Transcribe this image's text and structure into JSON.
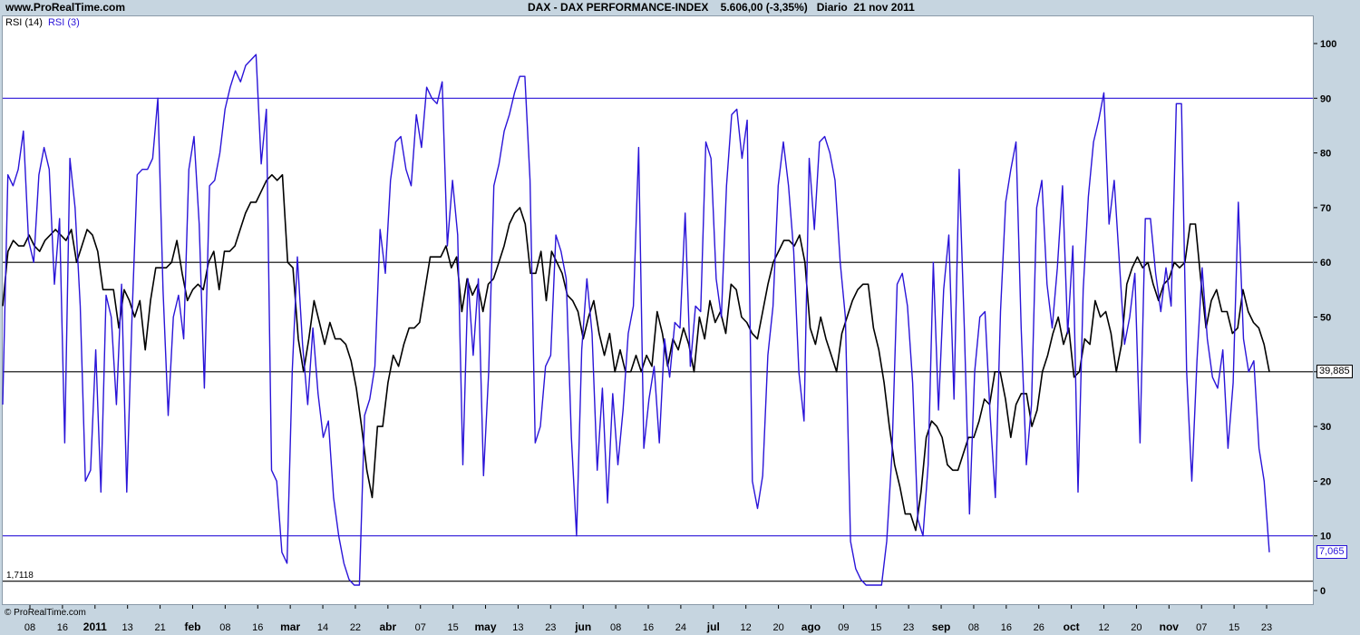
{
  "header": {
    "site": "www.ProRealTime.com",
    "title": "DAX - DAX PERFORMANCE-INDEX    5.606,00 (-3,35%)   Diario  21 nov 2011"
  },
  "legend": {
    "rsi14": "RSI (14)",
    "rsi3": "RSI (3)"
  },
  "footer": {
    "copyright": "© ProRealTime.com"
  },
  "floor_label": "1,7118",
  "value_labels": {
    "rsi14_last": "39,885",
    "rsi3_last": "7,065"
  },
  "colors": {
    "rsi14": "#000000",
    "rsi3": "#2a14d8",
    "band_high": "#2a14d8",
    "band_mid": "#000000"
  },
  "chart_data": {
    "type": "line",
    "title": "DAX - DAX PERFORMANCE-INDEX    5.606,00 (-3,35%)   Diario  21 nov 2011",
    "xlabel": "",
    "ylabel": "",
    "ylim": [
      0,
      100
    ],
    "yticks": [
      0,
      10,
      20,
      30,
      40,
      50,
      60,
      70,
      80,
      90,
      100
    ],
    "reference_lines": [
      {
        "value": 90,
        "color": "#2a14d8"
      },
      {
        "value": 60,
        "color": "#000000"
      },
      {
        "value": 40,
        "color": "#000000"
      },
      {
        "value": 10,
        "color": "#2a14d8"
      },
      {
        "value": 1.7118,
        "color": "#000000"
      }
    ],
    "xticks": [
      "08",
      "16",
      "2011",
      "13",
      "21",
      "feb",
      "08",
      "16",
      "mar",
      "14",
      "22",
      "abr",
      "07",
      "15",
      "may",
      "13",
      "23",
      "jun",
      "08",
      "16",
      "24",
      "jul",
      "12",
      "20",
      "ago",
      "09",
      "15",
      "23",
      "sep",
      "08",
      "16",
      "26",
      "oct",
      "12",
      "20",
      "nov",
      "07",
      "15",
      "23"
    ],
    "xtick_bold": [
      "2011",
      "feb",
      "mar",
      "abr",
      "may",
      "jun",
      "jul",
      "ago",
      "sep",
      "oct",
      "nov"
    ],
    "series": [
      {
        "name": "RSI (14)",
        "values": [
          52,
          62,
          64,
          63,
          63,
          65,
          63,
          62,
          64,
          65,
          66,
          65,
          64,
          66,
          60,
          63,
          66,
          65,
          62,
          55,
          55,
          55,
          48,
          55,
          53,
          50,
          53,
          44,
          53,
          59,
          59,
          59,
          60,
          64,
          58,
          53,
          55,
          56,
          55,
          60,
          62,
          55,
          62,
          62,
          63,
          66,
          69,
          71,
          71,
          73,
          75,
          76,
          75,
          76,
          60,
          59,
          46,
          40,
          46,
          53,
          49,
          45,
          49,
          46,
          46,
          45,
          42,
          37,
          30,
          22,
          17,
          30,
          30,
          38,
          43,
          41,
          45,
          48,
          48,
          49,
          55,
          61,
          61,
          61,
          63,
          59,
          61,
          51,
          57,
          54,
          56,
          51,
          56,
          57,
          60,
          63,
          67,
          69,
          70,
          67,
          58,
          58,
          62,
          53,
          62,
          60,
          58,
          54,
          53,
          51,
          46,
          50,
          53,
          47,
          43,
          47,
          40,
          44,
          40,
          40,
          43,
          40,
          43,
          41,
          51,
          47,
          41,
          46,
          44,
          48,
          45,
          40,
          50,
          46,
          53,
          49,
          51,
          47,
          56,
          55,
          50,
          49,
          47,
          46,
          51,
          56,
          60,
          62,
          64,
          64,
          63,
          65,
          60,
          48,
          45,
          50,
          46,
          43,
          40,
          47,
          50,
          53,
          55,
          56,
          56,
          48,
          44,
          38,
          30,
          23,
          19,
          14,
          14,
          11,
          18,
          28,
          31,
          30,
          28,
          23,
          22,
          22,
          25,
          28,
          28,
          31,
          35,
          34,
          40,
          40,
          35,
          28,
          34,
          36,
          36,
          30,
          33,
          40,
          43,
          47,
          50,
          45,
          48,
          39,
          40,
          46,
          45,
          53,
          50,
          51,
          47,
          40,
          45,
          56,
          59,
          61,
          59,
          60,
          56,
          53,
          56,
          57,
          60,
          59,
          60,
          67,
          67,
          57,
          48,
          53,
          55,
          51,
          51,
          47,
          48,
          55,
          51,
          49,
          48,
          45,
          40
        ]
      },
      {
        "name": "RSI (3)",
        "values": [
          34,
          76,
          74,
          77,
          84,
          64,
          60,
          76,
          81,
          77,
          56,
          68,
          27,
          79,
          70,
          52,
          20,
          22,
          44,
          18,
          54,
          50,
          34,
          56,
          18,
          50,
          76,
          77,
          77,
          79,
          90,
          55,
          32,
          50,
          54,
          46,
          77,
          83,
          67,
          37,
          74,
          75,
          80,
          88,
          92,
          95,
          93,
          96,
          97,
          98,
          78,
          88,
          22,
          20,
          7,
          5,
          40,
          61,
          45,
          34,
          48,
          36,
          28,
          31,
          17,
          10,
          5,
          2,
          1,
          1,
          32,
          35,
          41,
          66,
          58,
          75,
          82,
          83,
          77,
          74,
          87,
          81,
          92,
          90,
          89,
          93,
          63,
          75,
          65,
          23,
          57,
          43,
          57,
          21,
          40,
          74,
          78,
          84,
          87,
          91,
          94,
          94,
          75,
          27,
          30,
          41,
          43,
          65,
          62,
          57,
          28,
          10,
          44,
          57,
          47,
          22,
          37,
          16,
          36,
          23,
          33,
          47,
          52,
          81,
          26,
          35,
          41,
          27,
          46,
          39,
          49,
          48,
          69,
          41,
          52,
          51,
          82,
          79,
          57,
          50,
          74,
          87,
          88,
          79,
          86,
          20,
          15,
          21,
          43,
          52,
          74,
          82,
          74,
          62,
          40,
          31,
          79,
          66,
          82,
          83,
          80,
          75,
          60,
          50,
          9,
          4,
          2,
          1,
          1,
          1,
          1,
          9,
          25,
          56,
          58,
          52,
          38,
          13,
          10,
          23,
          60,
          33,
          55,
          65,
          35,
          77,
          48,
          14,
          40,
          50,
          51,
          32,
          17,
          51,
          71,
          77,
          82,
          48,
          23,
          34,
          70,
          75,
          56,
          48,
          59,
          74,
          47,
          63,
          18,
          55,
          72,
          82,
          86,
          91,
          67,
          75,
          60,
          45,
          50,
          58,
          27,
          68,
          68,
          58,
          51,
          59,
          52,
          89,
          89,
          40,
          20,
          42,
          59,
          46,
          39,
          37,
          44,
          26,
          38,
          71,
          46,
          40,
          42,
          26,
          20,
          7
        ]
      }
    ]
  }
}
